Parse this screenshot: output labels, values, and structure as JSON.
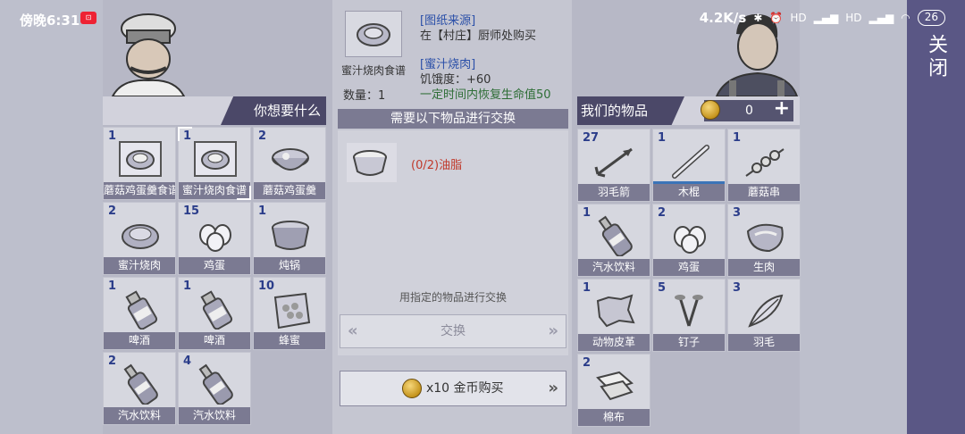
{
  "status_bar": {
    "time": "傍晚6:31",
    "net_speed": "4.2K/s",
    "battery": "26"
  },
  "close_label": "关闭",
  "left_panel": {
    "title": "你想要什么",
    "items": [
      {
        "qty": "1",
        "name": "蘑菇鸡蛋羹食谱",
        "icon": "recipe-scroll-icon"
      },
      {
        "qty": "1",
        "name": "蜜汁烧肉食谱",
        "icon": "recipe-scroll-icon",
        "selected": true
      },
      {
        "qty": "2",
        "name": "蘑菇鸡蛋羹",
        "icon": "soup-bowl-icon"
      },
      {
        "qty": "2",
        "name": "蜜汁烧肉",
        "icon": "roast-meat-icon"
      },
      {
        "qty": "15",
        "name": "鸡蛋",
        "icon": "eggs-icon"
      },
      {
        "qty": "1",
        "name": "炖锅",
        "icon": "pot-icon"
      },
      {
        "qty": "1",
        "name": "啤酒",
        "icon": "beer-bottle-icon"
      },
      {
        "qty": "1",
        "name": "啤酒",
        "icon": "beer-bottle-icon"
      },
      {
        "qty": "10",
        "name": "蜂蜜",
        "icon": "honeycomb-icon"
      },
      {
        "qty": "2",
        "name": "汽水饮料",
        "icon": "soda-bottle-icon"
      },
      {
        "qty": "4",
        "name": "汽水饮料",
        "icon": "soda-bottle-icon"
      }
    ]
  },
  "middle_panel": {
    "recipe_name": "蜜汁烧肉食谱",
    "quantity": "数量：1",
    "source_title": "[图纸来源]",
    "source_text": "在【村庄】厨师处购买",
    "product_title": "[蜜汁烧肉]",
    "hunger": "饥饿度：+60",
    "effect": "一定时间内恢复生命值50",
    "requirement_header": "需要以下物品进行交换",
    "requirement": "(0/2)油脂",
    "hint": "用指定的物品进行交换",
    "exchange_label": "交换",
    "buy_label": "x10 金币购买"
  },
  "right_panel": {
    "title": "我们的物品",
    "coins": "0",
    "items": [
      {
        "qty": "27",
        "name": "羽毛箭",
        "icon": "arrow-icon"
      },
      {
        "qty": "1",
        "name": "木棍",
        "icon": "stick-icon",
        "durability": 1.0
      },
      {
        "qty": "1",
        "name": "蘑菇串",
        "icon": "mushroom-skewer-icon"
      },
      {
        "qty": "1",
        "name": "汽水饮料",
        "icon": "soda-bottle-icon"
      },
      {
        "qty": "2",
        "name": "鸡蛋",
        "icon": "eggs-icon"
      },
      {
        "qty": "3",
        "name": "生肉",
        "icon": "raw-meat-icon"
      },
      {
        "qty": "1",
        "name": "动物皮革",
        "icon": "leather-icon"
      },
      {
        "qty": "5",
        "name": "钉子",
        "icon": "nails-icon"
      },
      {
        "qty": "3",
        "name": "羽毛",
        "icon": "feather-icon"
      },
      {
        "qty": "2",
        "name": "棉布",
        "icon": "cloth-icon"
      }
    ]
  },
  "colors": {
    "banner": "#4b4868",
    "cell_label": "#7b7a92",
    "qty_blue": "#2b3d8a",
    "requirement_red": "#c0392b",
    "close_bar": "#5a5785"
  }
}
